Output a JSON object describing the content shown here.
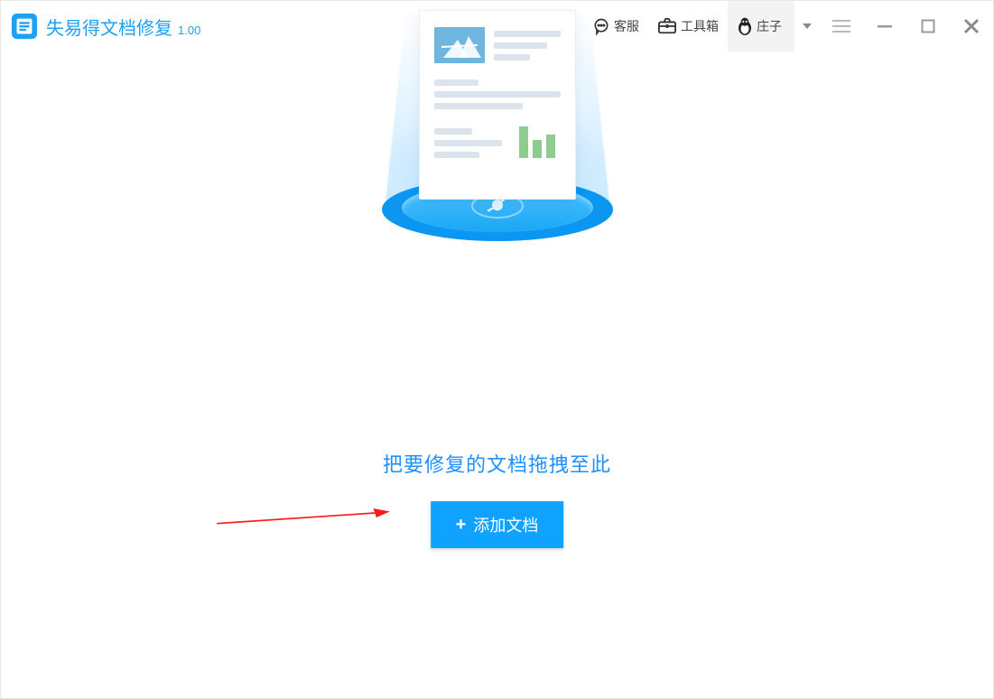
{
  "header": {
    "app_name": "失易得文档修复",
    "version": "1.00",
    "support_label": "客服",
    "toolbox_label": "工具箱",
    "user_name": "庄子"
  },
  "main": {
    "drop_hint": "把要修复的文档拖拽至此",
    "add_button_label": "添加文档",
    "add_button_plus": "+"
  }
}
